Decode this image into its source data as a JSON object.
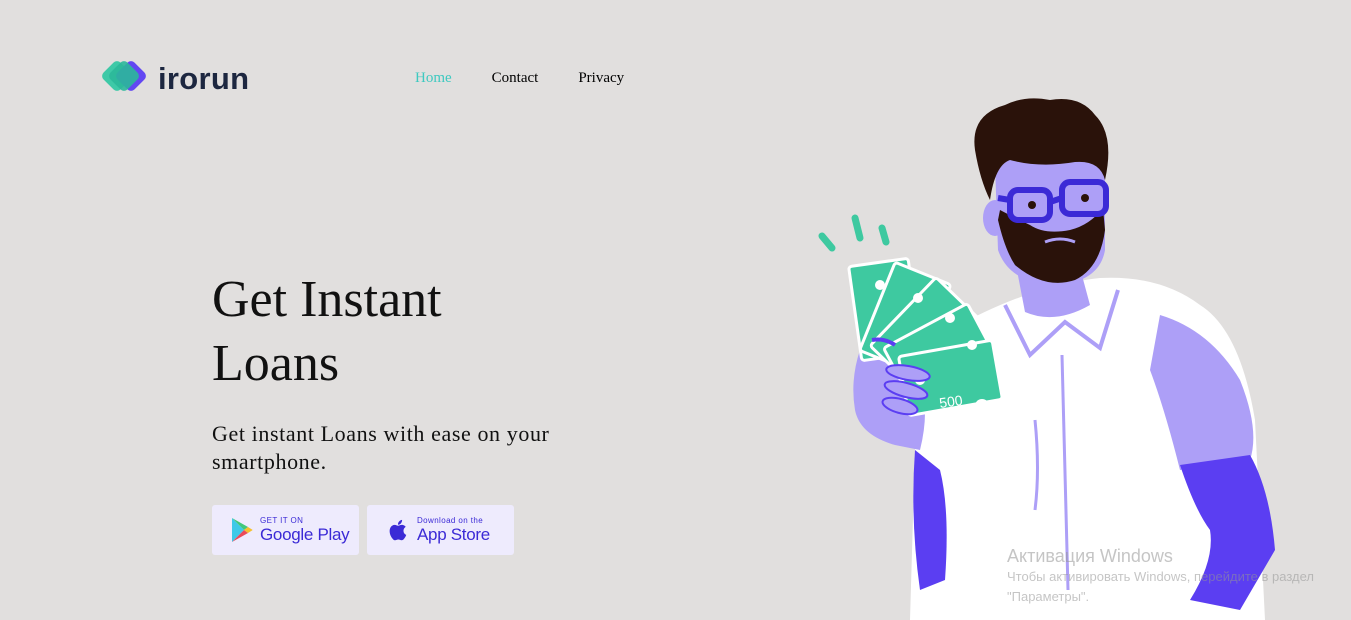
{
  "brand": {
    "name": "irorun",
    "colors": {
      "teal": "#3ec9a7",
      "purple": "#5b3ef2",
      "text": "#1d2740"
    }
  },
  "nav": {
    "items": [
      {
        "label": "Home",
        "active": true
      },
      {
        "label": "Contact",
        "active": false
      },
      {
        "label": "Privacy",
        "active": false
      }
    ],
    "active_color": "#3ec9c0"
  },
  "hero": {
    "title": "Get Instant Loans",
    "subtitle": "Get instant Loans with ease on your smartphone."
  },
  "stores": {
    "google": {
      "small": "GET IT ON",
      "big": "Google Play",
      "icon": "google-play-icon"
    },
    "apple": {
      "small": "Download on the",
      "big": "App Store",
      "icon": "apple-icon"
    },
    "button_bg": "#eeebfd",
    "text_color": "#3b2ad6"
  },
  "illustration": {
    "subject": "man-holding-cash-fan",
    "cash_label": "500",
    "colors": {
      "skin": "#ad9ff7",
      "cash": "#3ec9a0",
      "shirt": "#ffffff",
      "hair": "#2a120a",
      "accent": "#5b3ef2"
    }
  },
  "watermark": {
    "title": "Активация Windows",
    "text": "Чтобы активировать Windows, перейдите в раздел \"Параметры\"."
  }
}
